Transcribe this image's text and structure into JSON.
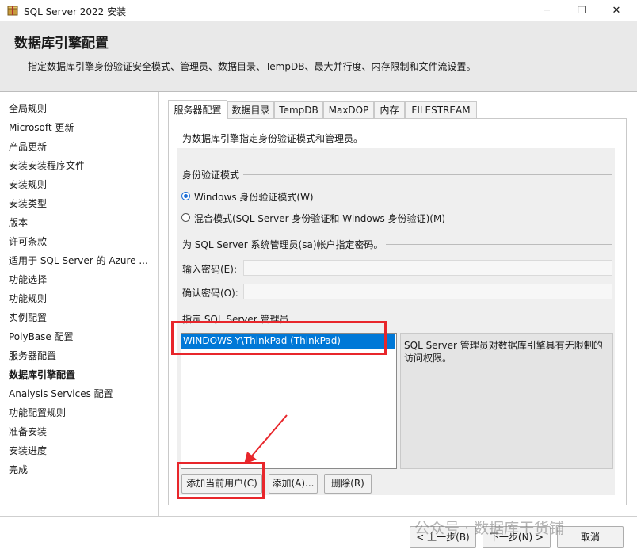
{
  "window": {
    "title": "SQL Server 2022 安装",
    "minimize": "─",
    "maximize": "☐",
    "close": "✕"
  },
  "header": {
    "title": "数据库引擎配置",
    "subtitle": "指定数据库引擎身份验证安全模式、管理员、数据目录、TempDB、最大并行度、内存限制和文件流设置。"
  },
  "sidebar": {
    "items": [
      {
        "label": "全局规则"
      },
      {
        "label": "Microsoft 更新"
      },
      {
        "label": "产品更新"
      },
      {
        "label": "安装安装程序文件"
      },
      {
        "label": "安装规则"
      },
      {
        "label": "安装类型"
      },
      {
        "label": "版本"
      },
      {
        "label": "许可条款"
      },
      {
        "label": "适用于 SQL Server 的 Azure ..."
      },
      {
        "label": "功能选择"
      },
      {
        "label": "功能规则"
      },
      {
        "label": "实例配置"
      },
      {
        "label": "PolyBase 配置"
      },
      {
        "label": "服务器配置"
      },
      {
        "label": "数据库引擎配置"
      },
      {
        "label": "Analysis Services 配置"
      },
      {
        "label": "功能配置规则"
      },
      {
        "label": "准备安装"
      },
      {
        "label": "安装进度"
      },
      {
        "label": "完成"
      }
    ],
    "active_index": 14
  },
  "tabs": [
    {
      "label": "服务器配置"
    },
    {
      "label": "数据目录"
    },
    {
      "label": "TempDB"
    },
    {
      "label": "MaxDOP"
    },
    {
      "label": "内存"
    },
    {
      "label": "FILESTREAM"
    }
  ],
  "panel": {
    "description": "为数据库引擎指定身份验证模式和管理员。",
    "auth_group_label": "身份验证模式",
    "radio_windows": "Windows 身份验证模式(W)",
    "radio_mixed": "混合模式(SQL Server 身份验证和 Windows 身份验证)(M)",
    "sa_group_label": "为 SQL Server 系统管理员(sa)帐户指定密码。",
    "password_label": "输入密码(E):",
    "confirm_label": "确认密码(O):",
    "admins_group_label": "指定 SQL Server 管理员",
    "admins": [
      "WINDOWS-Y\\ThinkPad (ThinkPad)"
    ],
    "admins_info": "SQL Server 管理员对数据库引擎具有无限制的访问权限。",
    "add_current_user": "添加当前用户(C)",
    "add": "添加(A)...",
    "remove": "删除(R)"
  },
  "footer": {
    "back": "< 上一步(B)",
    "next": "下一步(N) >",
    "cancel": "取消"
  },
  "watermark": "公众号 · 数据库干货铺",
  "colors": {
    "accent": "#0078d7",
    "highlight": "#e8262b",
    "header_bg": "#e9e9e9"
  }
}
